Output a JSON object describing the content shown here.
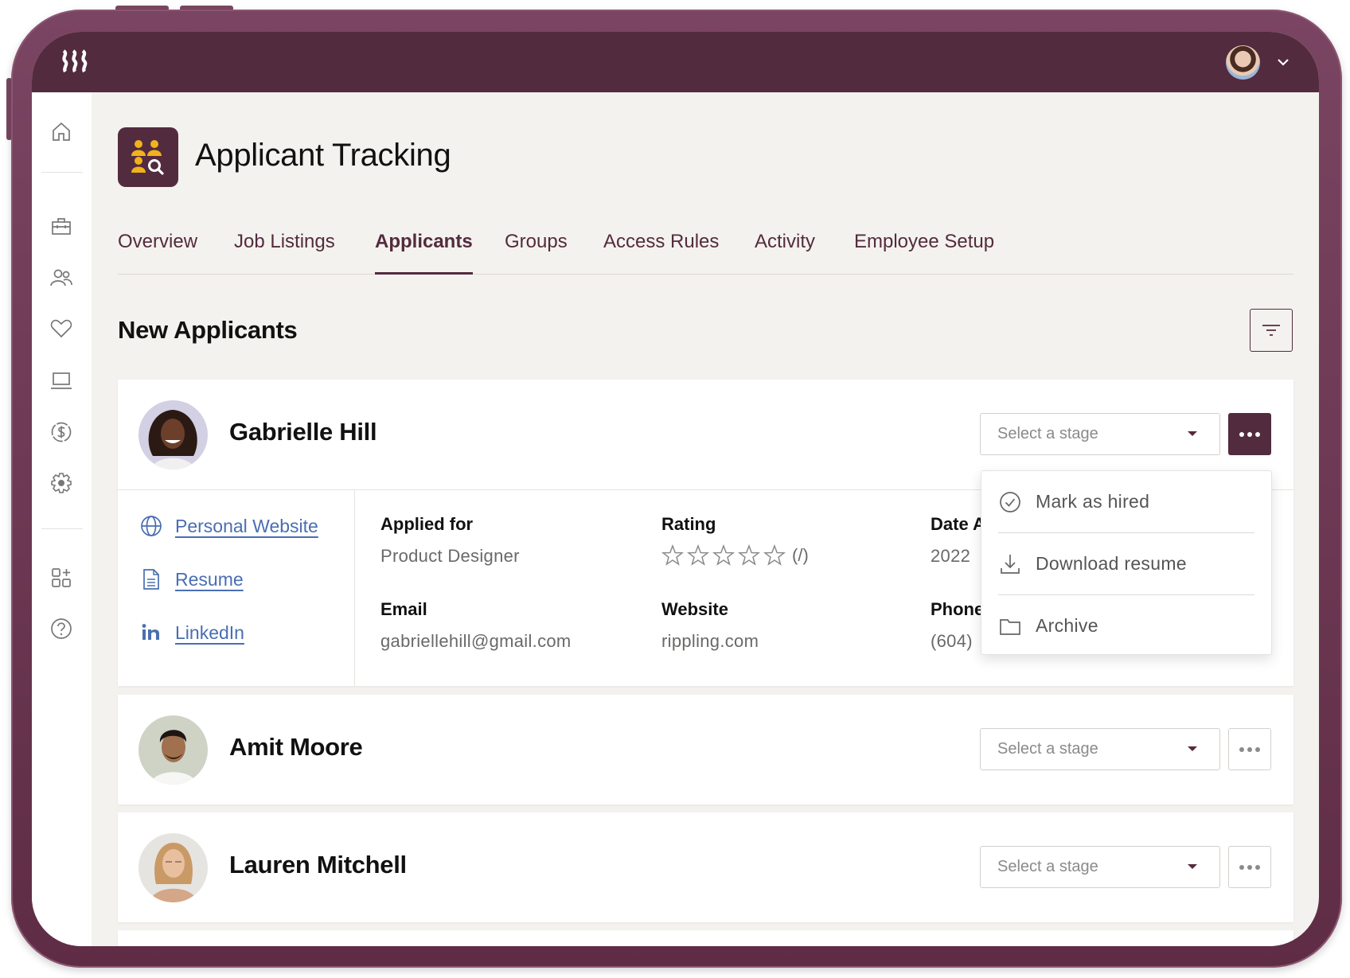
{
  "app": {
    "title": "Applicant Tracking",
    "logo_icon": "rippling-logo-icon",
    "app_icon": "applicant-search-icon",
    "user_menu_icon": "chevron-down-icon"
  },
  "colors": {
    "brand": "#532b3e",
    "frame": "#6b3550",
    "background": "#f4f2ee",
    "link": "#4a6eb3",
    "accent_gold": "#f2b21b"
  },
  "sidebar": {
    "items": [
      {
        "name": "home",
        "icon": "home-icon"
      },
      {
        "name": "briefcase",
        "icon": "briefcase-icon"
      },
      {
        "name": "people",
        "icon": "people-icon"
      },
      {
        "name": "benefits",
        "icon": "heart-icon"
      },
      {
        "name": "devices",
        "icon": "laptop-icon"
      },
      {
        "name": "finance",
        "icon": "dollar-icon"
      },
      {
        "name": "settings",
        "icon": "gear-icon"
      },
      {
        "name": "add-apps",
        "icon": "apps-plus-icon"
      },
      {
        "name": "help",
        "icon": "help-icon"
      }
    ]
  },
  "tabs": [
    {
      "label": "Overview",
      "active": false
    },
    {
      "label": "Job Listings",
      "active": false
    },
    {
      "label": "Applicants",
      "active": true
    },
    {
      "label": "Groups",
      "active": false
    },
    {
      "label": "Access Rules",
      "active": false
    },
    {
      "label": "Activity",
      "active": false
    },
    {
      "label": "Employee Setup",
      "active": false
    }
  ],
  "section": {
    "title": "New Applicants",
    "filter_icon": "filter-icon"
  },
  "applicants": [
    {
      "name": "Gabrielle Hill",
      "stage_placeholder": "Select a stage",
      "expanded": true,
      "links": [
        {
          "label": "Personal Website",
          "icon": "globe-icon"
        },
        {
          "label": "Resume",
          "icon": "document-icon"
        },
        {
          "label": "LinkedIn",
          "icon": "linkedin-icon"
        }
      ],
      "fields": {
        "applied_for": {
          "label": "Applied for",
          "value": "Product Designer"
        },
        "rating": {
          "label": "Rating",
          "stars_filled": 0,
          "stars_total": 5,
          "suffix": "(/)"
        },
        "date": {
          "label": "Date A",
          "value": "2022"
        },
        "email": {
          "label": "Email",
          "value": "gabriellehill@gmail.com"
        },
        "website": {
          "label": "Website",
          "value": "rippling.com"
        },
        "phone": {
          "label": "Phone",
          "value": "(604)"
        }
      }
    },
    {
      "name": "Amit Moore",
      "stage_placeholder": "Select a stage",
      "expanded": false
    },
    {
      "name": "Lauren Mitchell",
      "stage_placeholder": "Select a stage",
      "expanded": false
    }
  ],
  "actions_menu": {
    "items": [
      {
        "label": "Mark as hired",
        "icon": "check-circle-icon"
      },
      {
        "label": "Download resume",
        "icon": "download-icon"
      },
      {
        "label": "Archive",
        "icon": "folder-icon"
      }
    ]
  }
}
